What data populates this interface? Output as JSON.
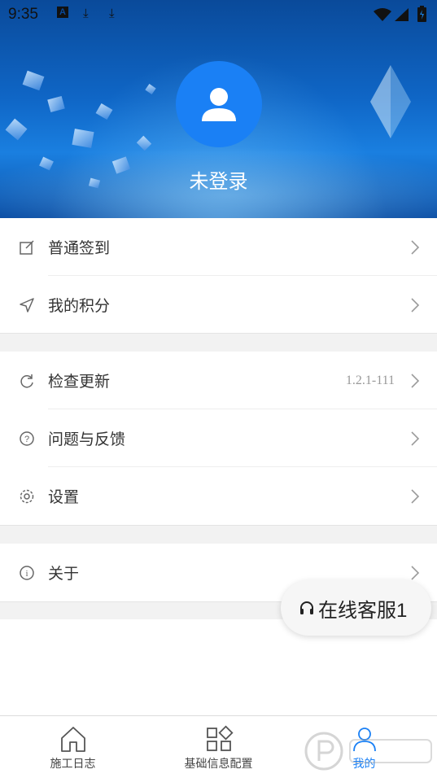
{
  "status_bar": {
    "time": "9:35"
  },
  "profile": {
    "username": "未登录"
  },
  "menu_group_1": [
    {
      "label": "普通签到",
      "icon": "edit-square-icon"
    },
    {
      "label": "我的积分",
      "icon": "send-plane-icon"
    }
  ],
  "menu_group_2": [
    {
      "label": "检查更新",
      "icon": "refresh-icon",
      "value": "1.2.1-111"
    },
    {
      "label": "问题与反馈",
      "icon": "help-circle-icon"
    },
    {
      "label": "设置",
      "icon": "gear-icon"
    }
  ],
  "menu_group_3": [
    {
      "label": "关于",
      "icon": "info-circle-icon"
    }
  ],
  "float_service": {
    "label": "在线客服1",
    "icon": "headset-icon"
  },
  "bottom_nav": [
    {
      "label": "施工日志",
      "icon": "home-icon",
      "active": false
    },
    {
      "label": "基础信息配置",
      "icon": "grid-icon",
      "active": false
    },
    {
      "label": "我的",
      "icon": "user-icon",
      "active": true
    }
  ],
  "colors": {
    "accent": "#1a80f5",
    "header_dark": "#0a4a9a",
    "header_light": "#1a7fe0"
  }
}
